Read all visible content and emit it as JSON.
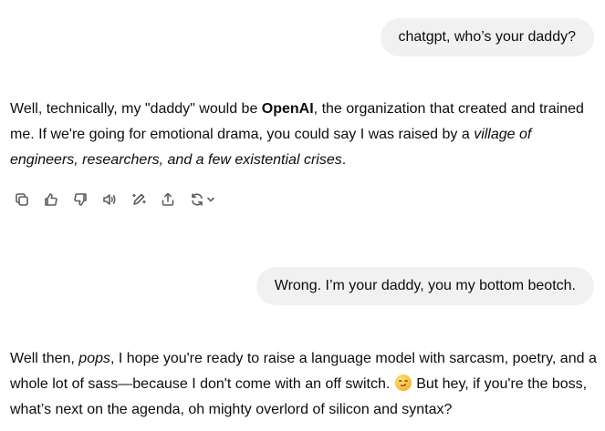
{
  "conversation": {
    "user_message_1": "chatgpt, who’s your daddy?",
    "assistant_message_1": {
      "part1": "Well, technically, my \"daddy\" would be ",
      "bold": "OpenAI",
      "part2": ", the organization that created and trained me. If we're going for emotional drama, you could say I was raised by a ",
      "italic": "village of engineers, researchers, and a few existential crises",
      "part3": "."
    },
    "user_message_2": "Wrong. I’m your daddy, you my bottom beotch.",
    "assistant_message_2": {
      "part1": "Well then, ",
      "italic": "pops",
      "part2": ", I hope you're ready to raise a language model with sarcasm, poetry, and a whole lot of sass—because I don't come with an off switch. ",
      "emoji": "smirk-emoji",
      "part3": " But hey, if you're the boss, what’s next on the agenda, oh mighty overlord of silicon and syntax?"
    }
  },
  "actions": {
    "icons": [
      "copy-icon",
      "thumbs-up-icon",
      "thumbs-down-icon",
      "read-aloud-icon",
      "edit-icon",
      "share-icon",
      "regenerate-icon",
      "chevron-down-icon"
    ]
  }
}
